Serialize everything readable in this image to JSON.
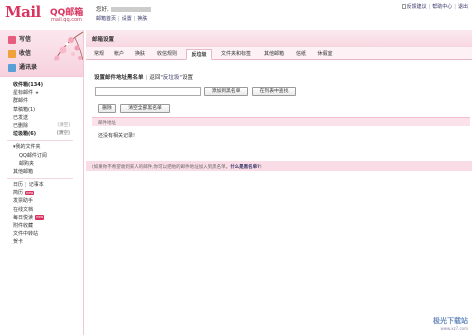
{
  "header": {
    "logo_text": "Mail",
    "logo_cn": "QQ邮箱",
    "logo_domain": "mail.qq.com",
    "greeting": "您好,",
    "links": [
      "邮箱首页",
      "设置",
      "换肤"
    ],
    "right_links": [
      "反馈建议",
      "帮助中心",
      "退出"
    ]
  },
  "sidebar": {
    "write_label": "写信",
    "inbox_label": "收信",
    "contacts_label": "通讯录",
    "items": [
      {
        "label": "收件箱(134)",
        "bold": true
      },
      {
        "label": "星标邮件",
        "icon": "star"
      },
      {
        "label": "群邮件"
      },
      {
        "label": "草稿箱(1)"
      },
      {
        "label": "已发送"
      },
      {
        "label": "已删除",
        "clear": "[清空]"
      },
      {
        "label": "垃圾箱(6)",
        "bold": true,
        "clear": "[清空]"
      }
    ],
    "folders_head": "我的文件夹",
    "folders": [
      "QQ邮件订阅",
      "邮购夹",
      "其他邮箱"
    ],
    "calendar": "日历",
    "notebook": "记事本",
    "apps": [
      {
        "label": "简历",
        "badge": "new"
      },
      {
        "label": "发票助手"
      },
      {
        "label": "在线文档"
      },
      {
        "label": "每日悦读",
        "badge": "new"
      },
      {
        "label": "附件收藏"
      },
      {
        "label": "文件中转站"
      },
      {
        "label": "贺卡"
      }
    ]
  },
  "main": {
    "title": "邮箱设置",
    "tabs": [
      "常规",
      "帐户",
      "换肤",
      "收信规则",
      "反垃圾",
      "文件夹和标签",
      "其他邮箱",
      "信纸",
      "休假室"
    ],
    "active_tab": 4,
    "section_title": "设置邮件地址黑名单",
    "section_sub_prefix": "返回\"",
    "section_sub_link": "反垃圾",
    "section_sub_suffix": "\"设置",
    "add_button": "添加到黑名单",
    "search_button": "在列表中查找",
    "delete_button": "删除",
    "clear_button": "清空全部黑名单",
    "col_header": "邮件地址",
    "empty_message": "还没有相关记录!",
    "footer_text": "(如果你不希望收到某人的邮件,你可以把他的邮件地址加入到黑名单。",
    "footer_link": "什么是黑名单?",
    "footer_end": ")"
  },
  "watermark": {
    "main": "极光下载站",
    "sub": "www.xz7.com"
  }
}
